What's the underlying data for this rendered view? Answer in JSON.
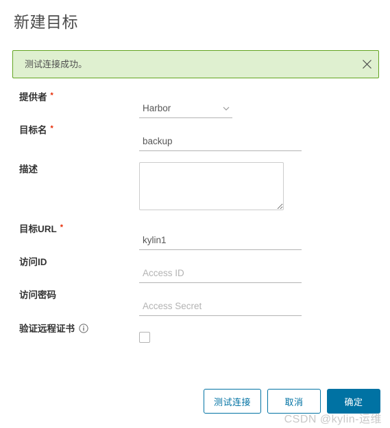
{
  "page": {
    "title": "新建目标"
  },
  "alert": {
    "message": "测试连接成功。",
    "type": "success",
    "bg_color": "#dff0d0",
    "border_color": "#62a420",
    "close_icon": "close-icon"
  },
  "form": {
    "fields": [
      {
        "label": "提供者",
        "required": "*",
        "control": "select",
        "value": "Harbor",
        "options": [
          "Harbor"
        ]
      },
      {
        "label": "目标名",
        "required": "*",
        "control": "text",
        "value": "backup",
        "placeholder": ""
      },
      {
        "label": "描述",
        "required": "",
        "control": "textarea",
        "value": "",
        "placeholder": ""
      },
      {
        "label": "目标URL",
        "required": "*",
        "control": "text",
        "value": "kylin1",
        "placeholder": ""
      },
      {
        "label": "访问ID",
        "required": "",
        "control": "text",
        "value": "",
        "placeholder": "Access ID"
      },
      {
        "label": "访问密码",
        "required": "",
        "control": "password",
        "value": "",
        "placeholder": "Access Secret"
      },
      {
        "label": "验证远程证书",
        "required": "",
        "control": "checkbox",
        "checked": false,
        "info_icon": "info-circle-icon"
      }
    ]
  },
  "buttons": {
    "test_connection": "测试连接",
    "cancel": "取消",
    "confirm": "确定",
    "primary_color": "#0072a3"
  },
  "watermark": {
    "text": "CSDN @kylin-运维"
  }
}
